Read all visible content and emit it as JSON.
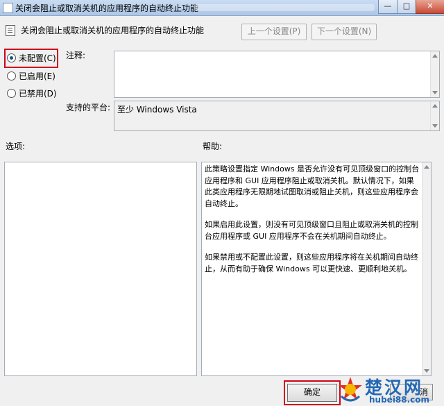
{
  "window": {
    "title": "关闭会阻止或取消关机的应用程序的自动终止功能",
    "minimize_glyph": "—",
    "maximize_glyph": "□",
    "close_glyph": "✕"
  },
  "header": {
    "policy_title": "关闭会阻止或取消关机的应用程序的自动终止功能",
    "prev_setting": "上一个设置(P)",
    "next_setting": "下一个设置(N)"
  },
  "state": {
    "options": [
      {
        "label": "未配置(C)",
        "selected": true
      },
      {
        "label": "已启用(E)",
        "selected": false
      },
      {
        "label": "已禁用(D)",
        "selected": false
      }
    ],
    "highlight_color": "#d0021b"
  },
  "comment": {
    "label": "注释:",
    "value": ""
  },
  "platform": {
    "label": "支持的平台:",
    "value": "至少 Windows Vista"
  },
  "options_panel": {
    "label": "选项:"
  },
  "help_panel": {
    "label": "帮助:",
    "paragraphs": [
      "此策略设置指定 Windows 是否允许没有可见顶级窗口的控制台应用程序和 GUI 应用程序阻止或取消关机。默认情况下，如果此类应用程序无限期地试图取消或阻止关机，则这些应用程序会自动终止。",
      "如果启用此设置，则没有可见顶级窗口且阻止或取消关机的控制台应用程序或 GUI 应用程序不会在关机期间自动终止。",
      "如果禁用或不配置此设置，则这些应用程序将在关机期间自动终止，从而有助于确保 Windows 可以更快速、更顺利地关机。"
    ]
  },
  "footer": {
    "ok": "确定",
    "cancel_partial": "消"
  },
  "watermark": {
    "text_cn": "楚汉网",
    "text_en": "hubei88.com",
    "color": "#2468b4"
  }
}
